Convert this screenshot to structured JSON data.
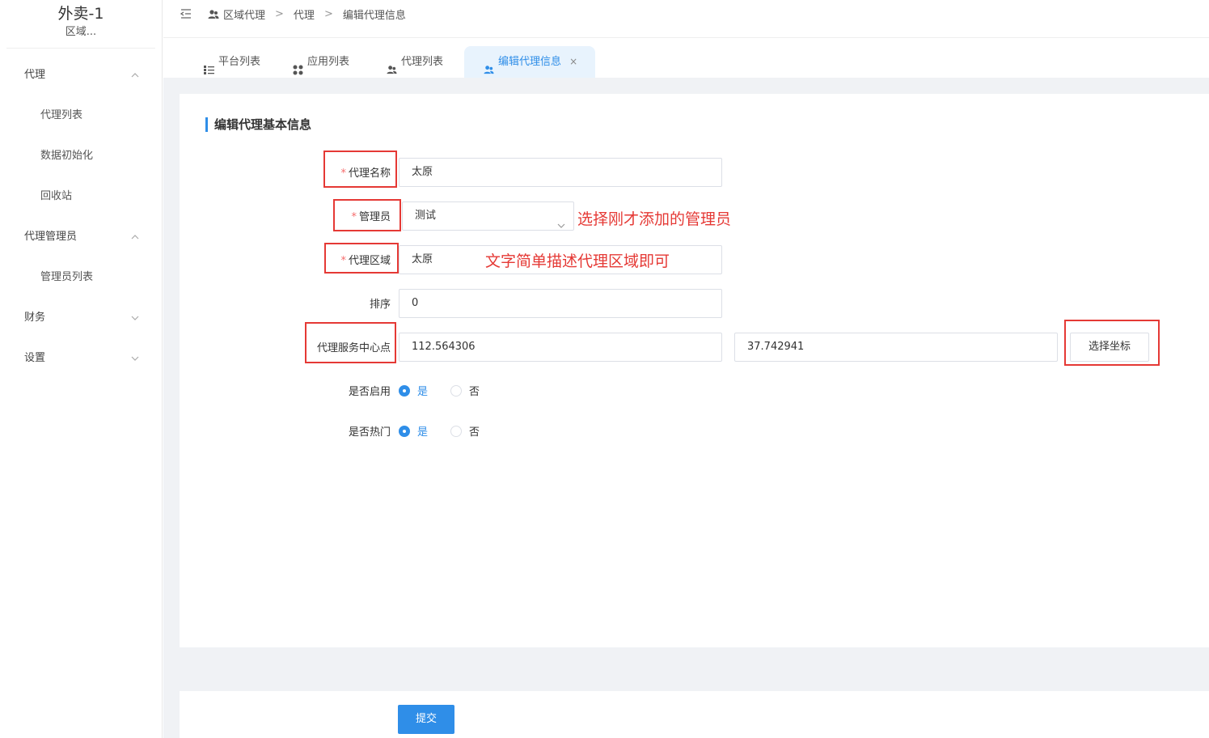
{
  "sidebar": {
    "app_title": "外卖-1",
    "app_subtitle": "区域...",
    "items": [
      {
        "label": "代理",
        "level": 1,
        "chevron": "chevron-up-icon"
      },
      {
        "label": "代理列表",
        "level": 2
      },
      {
        "label": "数据初始化",
        "level": 2
      },
      {
        "label": "回收站",
        "level": 2
      },
      {
        "label": "代理管理员",
        "level": 1,
        "chevron": "chevron-up-icon"
      },
      {
        "label": "管理员列表",
        "level": 2
      },
      {
        "label": "财务",
        "level": 1,
        "chevron": "chevron-down-icon"
      },
      {
        "label": "设置",
        "level": 1,
        "chevron": "chevron-down-icon"
      }
    ]
  },
  "header": {
    "breadcrumb": [
      "区域代理",
      "代理",
      "编辑代理信息"
    ],
    "separator": ">"
  },
  "tabs": [
    {
      "label": "平台列表",
      "icon": "list-icon"
    },
    {
      "label": "应用列表",
      "icon": "grid-icon"
    },
    {
      "label": "代理列表",
      "icon": "users-icon"
    },
    {
      "label": "编辑代理信息",
      "icon": "users-icon",
      "active": true,
      "close": "×"
    }
  ],
  "form": {
    "section_title": "编辑代理基本信息",
    "agent_name": {
      "label": "代理名称",
      "value": "太原"
    },
    "manager": {
      "label": "管理员",
      "value": "测试"
    },
    "region": {
      "label": "代理区域",
      "value": "太原"
    },
    "sort": {
      "label": "排序",
      "value": "0"
    },
    "center": {
      "label": "代理服务中心点",
      "lng": "112.564306",
      "lat": "37.742941",
      "pick_label": "选择坐标"
    },
    "enabled": {
      "label": "是否启用",
      "yes": "是",
      "no": "否",
      "selected": "是"
    },
    "hot": {
      "label": "是否热门",
      "yes": "是",
      "no": "否",
      "selected": "是"
    },
    "submit_label": "提交"
  },
  "annotations": {
    "manager_note": "选择刚才添加的管理员",
    "region_note": "文字简单描述代理区域即可"
  },
  "colors": {
    "accent": "#2f8ee8",
    "annotation_red": "#e53935",
    "required": "#f56c6c",
    "page_bg": "#f0f2f5"
  }
}
